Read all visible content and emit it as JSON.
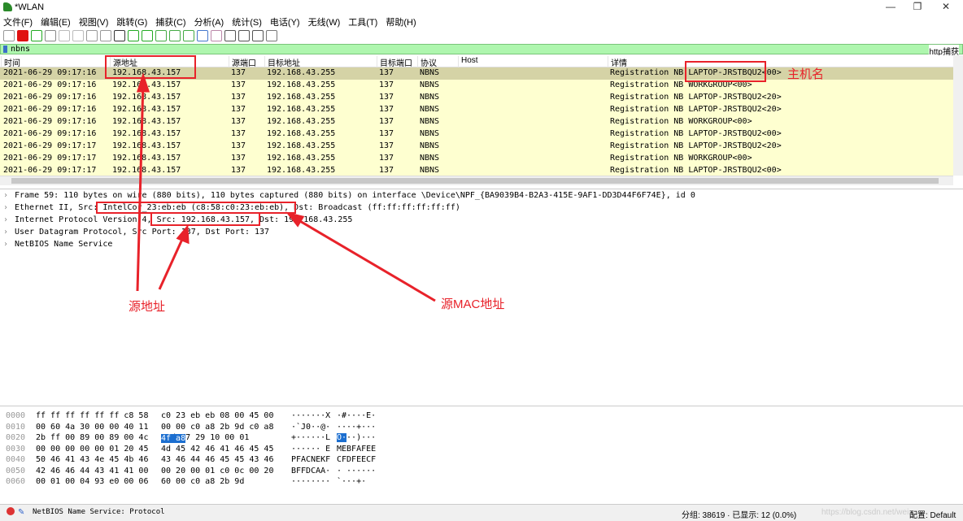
{
  "window": {
    "title": "*WLAN",
    "minimize": "—",
    "maximize": "❐",
    "close": "✕"
  },
  "menu": [
    "文件(F)",
    "编辑(E)",
    "视图(V)",
    "跳转(G)",
    "捕获(C)",
    "分析(A)",
    "统计(S)",
    "电话(Y)",
    "无线(W)",
    "工具(T)",
    "帮助(H)"
  ],
  "toolbar_icons": [
    "shark-fin-icon",
    "stop-icon",
    "restart-icon",
    "options-icon",
    "open-icon",
    "file-icon",
    "close-file-icon",
    "reload-icon",
    "find-icon",
    "back-icon",
    "forward-icon",
    "goto-icon",
    "first-icon",
    "last-icon",
    "autoscroll-icon",
    "colorize-icon",
    "zoom-in-icon",
    "zoom-out-icon",
    "zoom-reset-icon",
    "resize-columns-icon"
  ],
  "filter": {
    "value": "nbns",
    "expression_button": "http捕获",
    "plus": "+"
  },
  "columns": [
    "时间",
    "源地址",
    "源端口",
    "目标地址",
    "目标端口",
    "协议",
    "Host",
    "详情"
  ],
  "packets": [
    [
      "2021-06-29 09:17:16",
      "192.168.43.157",
      "137",
      "192.168.43.255",
      "137",
      "NBNS",
      "",
      "Registration NB LAPTOP-JRSTBQU2<00>"
    ],
    [
      "2021-06-29 09:17:16",
      "192.168.43.157",
      "137",
      "192.168.43.255",
      "137",
      "NBNS",
      "",
      "Registration NB WORKGROUP<00>"
    ],
    [
      "2021-06-29 09:17:16",
      "192.168.43.157",
      "137",
      "192.168.43.255",
      "137",
      "NBNS",
      "",
      "Registration NB LAPTOP-JRSTBQU2<20>"
    ],
    [
      "2021-06-29 09:17:16",
      "192.168.43.157",
      "137",
      "192.168.43.255",
      "137",
      "NBNS",
      "",
      "Registration NB LAPTOP-JRSTBQU2<20>"
    ],
    [
      "2021-06-29 09:17:16",
      "192.168.43.157",
      "137",
      "192.168.43.255",
      "137",
      "NBNS",
      "",
      "Registration NB WORKGROUP<00>"
    ],
    [
      "2021-06-29 09:17:16",
      "192.168.43.157",
      "137",
      "192.168.43.255",
      "137",
      "NBNS",
      "",
      "Registration NB LAPTOP-JRSTBQU2<00>"
    ],
    [
      "2021-06-29 09:17:17",
      "192.168.43.157",
      "137",
      "192.168.43.255",
      "137",
      "NBNS",
      "",
      "Registration NB LAPTOP-JRSTBQU2<20>"
    ],
    [
      "2021-06-29 09:17:17",
      "192.168.43.157",
      "137",
      "192.168.43.255",
      "137",
      "NBNS",
      "",
      "Registration NB WORKGROUP<00>"
    ],
    [
      "2021-06-29 09:17:17",
      "192.168.43.157",
      "137",
      "192.168.43.255",
      "137",
      "NBNS",
      "",
      "Registration NB LAPTOP-JRSTBQU2<00>"
    ]
  ],
  "details": [
    "Frame 59: 110 bytes on wire (880 bits), 110 bytes captured (880 bits) on interface \\Device\\NPF_{BA9039B4-B2A3-415E-9AF1-DD3D44F6F74E}, id 0",
    "Ethernet II, Src: IntelCor_23:eb:eb (c8:58:c0:23:eb:eb), Dst: Broadcast (ff:ff:ff:ff:ff:ff)",
    "Internet Protocol Version 4, Src: 192.168.43.157, Dst: 192.168.43.255",
    "User Datagram Protocol, Src Port: 137, Dst Port: 137",
    "NetBIOS Name Service"
  ],
  "hex": [
    [
      "0000",
      "ff ff ff ff ff ff c8 58",
      "c0 23 eb eb 08 00 45 00",
      "·······X",
      "·#····E·"
    ],
    [
      "0010",
      "00 60 4a 30 00 00 40 11",
      "00 00 c0 a8 2b 9d c0 a8",
      "·`J0··@·",
      "····+···"
    ],
    [
      "0020",
      "2b ff 00 89 00 89 00 4c",
      "4f a8 8d c7 29 10 00 01",
      "+······L",
      "O···)···"
    ],
    [
      "0030",
      "00 00 00 00 00 01 20 45",
      "4d 45 42 46 41 46 45 45",
      "······ E",
      "MEBFAFEE"
    ],
    [
      "0040",
      "50 46 41 43 4e 45 4b 46",
      "43 46 44 46 45 45 43 46",
      "PFACNEKF",
      "CFDFEECF"
    ],
    [
      "0050",
      "42 46 46 44 43 41 41 00",
      "00 20 00 01 c0 0c 00 20",
      "BFFDCAA·",
      "· ······"
    ],
    [
      "0060",
      "00 01 00 04 93 e0 00 06",
      "60 00 c0 a8 2b 9d",
      "········",
      "`···+·"
    ]
  ],
  "hex_highlight": {
    "hex": "4f a8",
    "ascii": "O·"
  },
  "status": {
    "field": "NetBIOS Name Service: Protocol",
    "packets": "分组: 38619 · 已显示: 12 (0.0%)",
    "profile": "配置: Default",
    "watermark": "https://blog.csdn.net/wei..."
  },
  "annotations": {
    "hostname": "主机名",
    "src_addr": "源地址",
    "src_mac": "源MAC地址",
    "color": "#e8222a"
  }
}
